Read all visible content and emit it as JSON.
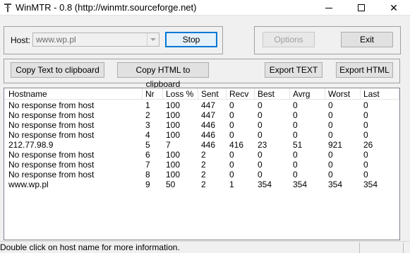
{
  "window": {
    "title": "WinMTR - 0.8 (http://winmtr.sourceforge.net)"
  },
  "host": {
    "label": "Host:",
    "value": "www.wp.pl"
  },
  "buttons": {
    "stop": "Stop",
    "options": "Options",
    "exit": "Exit",
    "copy_text": "Copy Text to clipboard",
    "copy_html": "Copy HTML to clipboard",
    "export_text": "Export TEXT",
    "export_html": "Export HTML"
  },
  "table": {
    "columns": [
      "Hostname",
      "Nr",
      "Loss %",
      "Sent",
      "Recv",
      "Best",
      "Avrg",
      "Worst",
      "Last"
    ],
    "rows": [
      [
        "No response from host",
        "1",
        "100",
        "447",
        "0",
        "0",
        "0",
        "0",
        "0"
      ],
      [
        "No response from host",
        "2",
        "100",
        "447",
        "0",
        "0",
        "0",
        "0",
        "0"
      ],
      [
        "No response from host",
        "3",
        "100",
        "446",
        "0",
        "0",
        "0",
        "0",
        "0"
      ],
      [
        "No response from host",
        "4",
        "100",
        "446",
        "0",
        "0",
        "0",
        "0",
        "0"
      ],
      [
        "212.77.98.9",
        "5",
        "7",
        "446",
        "416",
        "23",
        "51",
        "921",
        "26"
      ],
      [
        "No response from host",
        "6",
        "100",
        "2",
        "0",
        "0",
        "0",
        "0",
        "0"
      ],
      [
        "No response from host",
        "7",
        "100",
        "2",
        "0",
        "0",
        "0",
        "0",
        "0"
      ],
      [
        "No response from host",
        "8",
        "100",
        "2",
        "0",
        "0",
        "0",
        "0",
        "0"
      ],
      [
        "www.wp.pl",
        "9",
        "50",
        "2",
        "1",
        "354",
        "354",
        "354",
        "354"
      ]
    ]
  },
  "status": {
    "text": "Double click on host name for more information."
  },
  "icons": [
    "app-icon",
    "minimize-icon",
    "maximize-icon",
    "close-icon",
    "chevron-down-icon"
  ]
}
